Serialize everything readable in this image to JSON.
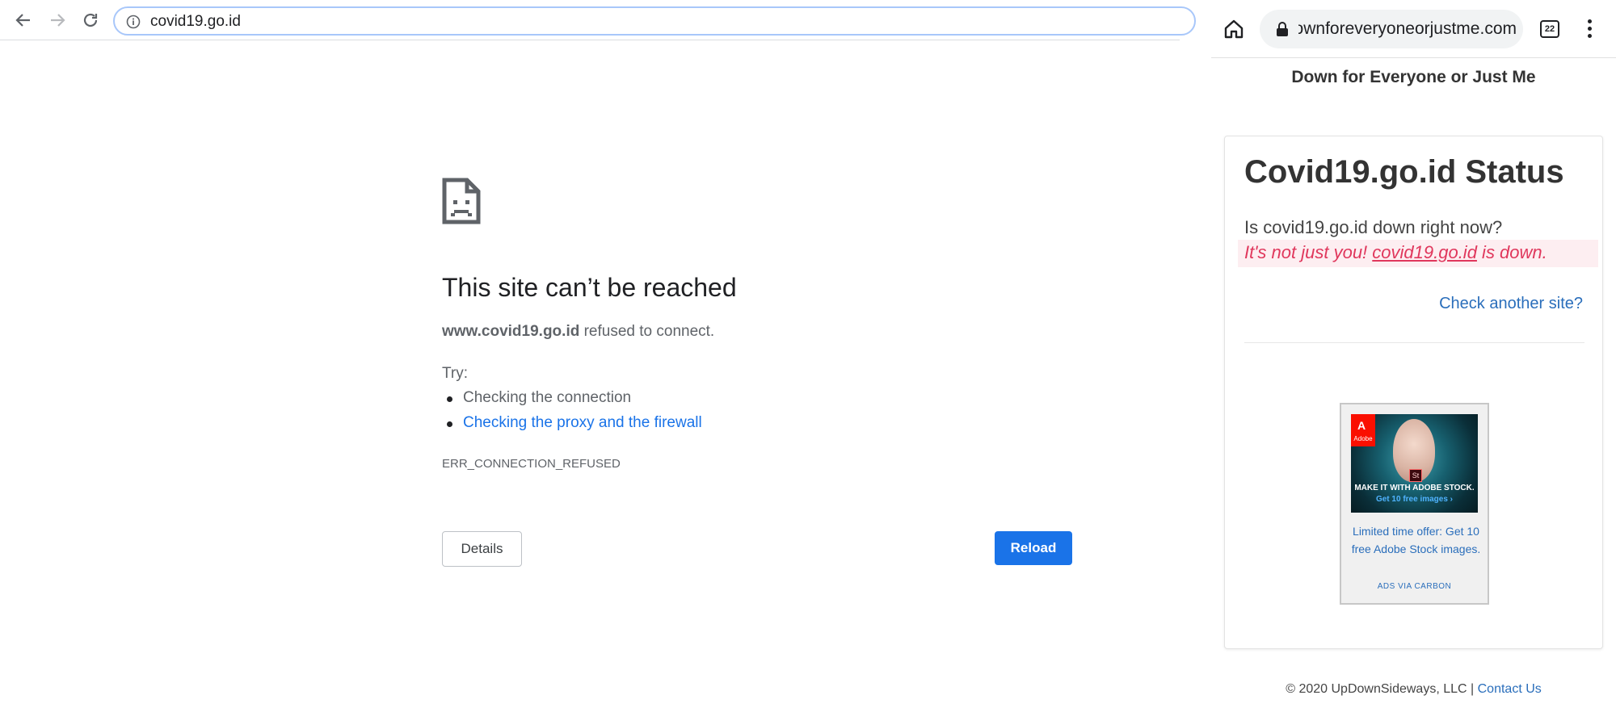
{
  "browser": {
    "url": "covid19.go.id"
  },
  "error_page": {
    "title": "This site can’t be reached",
    "host": "www.covid19.go.id",
    "message": " refused to connect.",
    "try_label": "Try:",
    "suggestions": [
      {
        "text": "Checking the connection",
        "link": false
      },
      {
        "text": "Checking the proxy and the firewall",
        "link": true
      }
    ],
    "error_code": "ERR_CONNECTION_REFUSED",
    "details_label": "Details",
    "reload_label": "Reload",
    "accent": "#1a73e8"
  },
  "mobile": {
    "url": "downforeveryoneorjustme.com",
    "tab_count": "22",
    "site_title": "Down for Everyone or Just Me",
    "card": {
      "title": "Covid19.go.id Status",
      "question": "Is covid19.go.id down right now?",
      "answer_prefix": "It's not just you! ",
      "answer_link": "covid19.go.id",
      "answer_suffix": " is down.",
      "check_link": "Check another site?",
      "status_color": "#e0375c"
    },
    "ad": {
      "logo_text": "Adobe",
      "badge": "St",
      "headline": "MAKE IT WITH ADOBE STOCK.",
      "subline": "Get 10 free images ›",
      "text": "Limited time offer: Get 10 free Adobe Stock images.",
      "via": "ADS VIA CARBON"
    },
    "footer": {
      "copyright": "© 2020 UpDownSideways, LLC | ",
      "contact": "Contact Us"
    }
  }
}
